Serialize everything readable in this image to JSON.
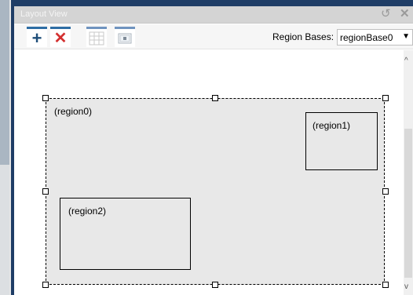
{
  "window": {
    "title": "Layout View",
    "restore_icon": "↺",
    "close_icon": "✕"
  },
  "toolbar": {
    "add_icon": "+",
    "delete_icon": "✕",
    "bases_label": "Region Bases:",
    "bases_value": "regionBase0",
    "dropdown_arrow": "▼"
  },
  "regions": {
    "r0_label": "(region0)",
    "r1_label": "(region1)",
    "r2_label": "(region2)"
  },
  "scroll": {
    "up_arrow": "^",
    "down_arrow": "v"
  },
  "colors": {
    "frame": "#1f3d66",
    "accent": "#2e6da4",
    "delete": "#d32f2f",
    "canvas_bg": "#e8e8e8"
  }
}
